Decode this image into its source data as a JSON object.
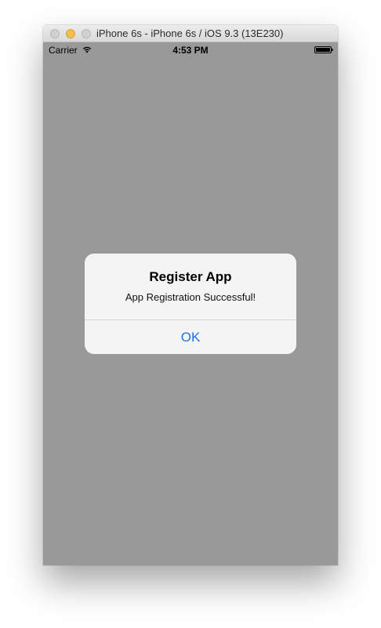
{
  "window": {
    "title": "iPhone 6s - iPhone 6s / iOS 9.3 (13E230)"
  },
  "status_bar": {
    "carrier": "Carrier",
    "time": "4:53 PM",
    "icons": [
      "wifi-icon",
      "battery-icon"
    ]
  },
  "alert": {
    "title": "Register App",
    "message": "App Registration Successful!",
    "button_label": "OK"
  },
  "colors": {
    "screen_dim": "#999999",
    "alert_background": "#f4f4f4",
    "button_tint": "#1a73e8",
    "minimize_button": "#f5bd4f"
  }
}
